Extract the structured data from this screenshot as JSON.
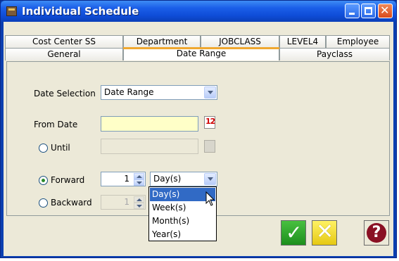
{
  "window": {
    "title": "Individual Schedule"
  },
  "tabs": {
    "back_row": [
      "Cost Center SS",
      "Department",
      "JOBCLASS",
      "LEVEL4",
      "Employee"
    ],
    "front_row": [
      "General",
      "Date Range",
      "Payclass"
    ],
    "active": "Date Range"
  },
  "form": {
    "date_selection_label": "Date Selection",
    "date_selection_value": "Date Range",
    "from_date_label": "From Date",
    "from_date_value": "",
    "until_label": "Until",
    "until_value": "",
    "forward_label": "Forward",
    "forward_count": "1",
    "forward_unit": "Day(s)",
    "backward_label": "Backward",
    "backward_count": "1",
    "calendar_icon_text": "12"
  },
  "unit_dropdown": {
    "options": [
      "Day(s)",
      "Week(s)",
      "Month(s)",
      "Year(s)"
    ],
    "highlighted": "Day(s)"
  },
  "colors": {
    "from_date_bg": "#ffffc8",
    "accent_tab": "#f0a830",
    "ok_green": "#2fa82f",
    "cancel_yellow": "#f0d820",
    "help_red": "#8a1024"
  },
  "icons": {
    "ok": "check-icon",
    "cancel": "x-icon",
    "help": "question-mark-icon",
    "calendar": "calendar-icon"
  }
}
